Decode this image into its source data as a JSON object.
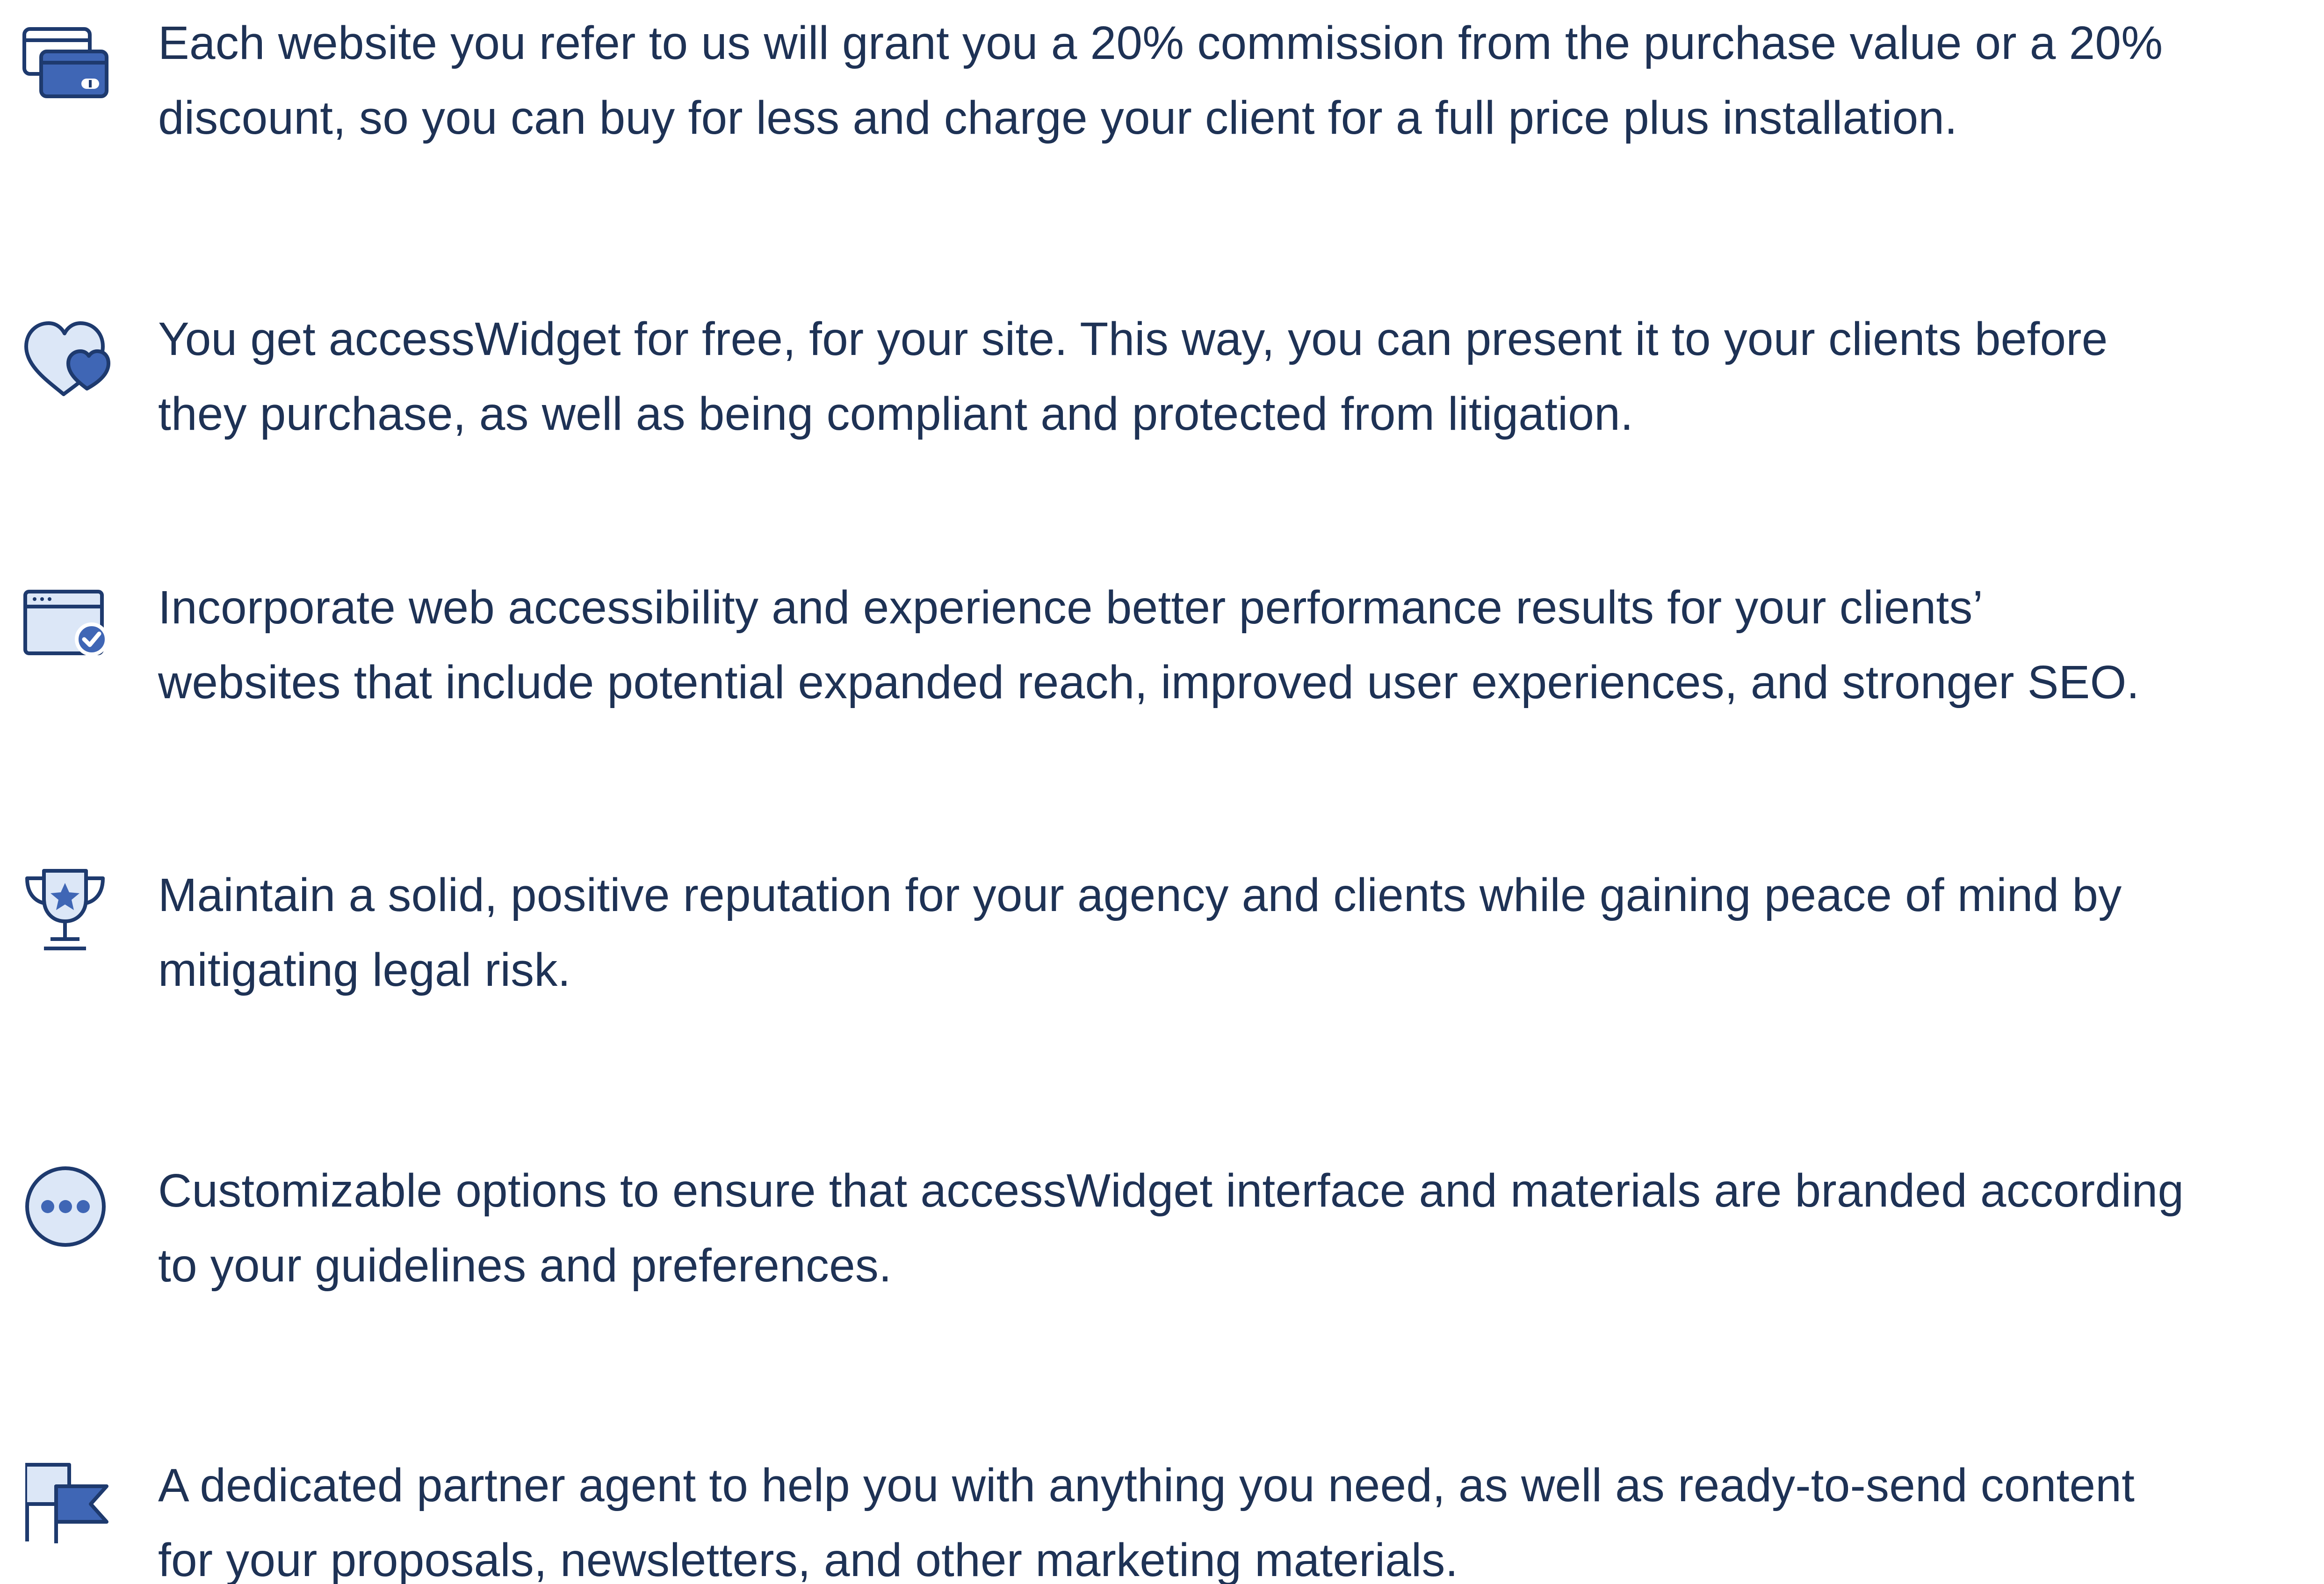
{
  "benefits": [
    {
      "icon": "credit-card-icon",
      "lines": [
        "Each website you refer to us will grant you a 20% commission from the purchase value or a 20%",
        "discount, so you can buy for less and charge your client for a full price plus installation."
      ]
    },
    {
      "icon": "hearts-icon",
      "lines": [
        "You get accessWidget for free, for your site. This way, you can present it to your clients before",
        "they purchase, as well as being compliant and protected from litigation."
      ]
    },
    {
      "icon": "browser-check-icon",
      "lines": [
        "Incorporate web accessibility and experience better performance results for your clients’",
        "websites that include potential expanded reach, improved user experiences, and stronger SEO."
      ]
    },
    {
      "icon": "trophy-star-icon",
      "lines": [
        "Maintain a solid, positive reputation for your agency and clients while gaining peace of mind by",
        "mitigating legal risk."
      ]
    },
    {
      "icon": "more-options-icon",
      "lines": [
        "Customizable options to ensure that accessWidget interface and materials are branded according",
        "to your guidelines and preferences."
      ]
    },
    {
      "icon": "flags-icon",
      "lines": [
        "A dedicated partner agent to help you with anything you need, as well as ready-to-send content",
        "for your proposals, newsletters, and other marketing materials."
      ]
    }
  ],
  "colors": {
    "text": "#1e3255",
    "icon_stroke": "#1e3a6e",
    "icon_fill_dark": "#3f66b5",
    "icon_fill_light": "#dce7f7"
  }
}
